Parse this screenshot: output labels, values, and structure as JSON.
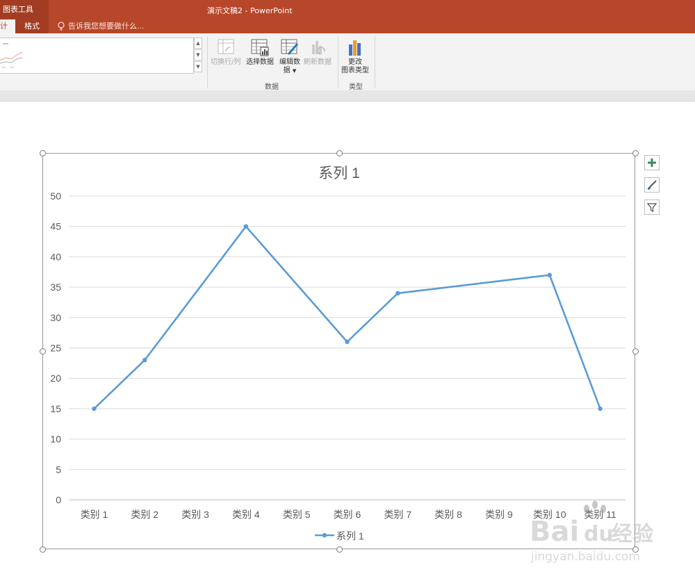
{
  "titlebar": {
    "context_tab": "图表工具",
    "window_title": "演示文稿2 - PowerPoint",
    "tabs": [
      {
        "label": "计",
        "active": true
      },
      {
        "label": "格式",
        "active": false
      }
    ],
    "tell_me": "告诉我您想要做什么..."
  },
  "ribbon": {
    "data_group": {
      "label": "数据",
      "buttons": [
        {
          "label": "切换行/列",
          "enabled": false,
          "icon": "switch-row-column-icon"
        },
        {
          "label": "选择数据",
          "enabled": true,
          "icon": "select-data-icon"
        },
        {
          "label_line1": "编辑数",
          "label_line2": "据",
          "enabled": true,
          "icon": "edit-data-icon"
        },
        {
          "label": "刷新数据",
          "enabled": false,
          "icon": "refresh-data-icon"
        }
      ]
    },
    "type_group": {
      "label": "类型",
      "button": {
        "label_line1": "更改",
        "label_line2": "图表类型",
        "icon": "change-chart-type-icon"
      }
    },
    "gallery_scroll": {
      "up": "▲",
      "down": "▼",
      "more": "▼"
    }
  },
  "chart_data": {
    "type": "line",
    "title": "系列 1",
    "categories": [
      "类别 1",
      "类别 2",
      "类别 3",
      "类别 4",
      "类别 5",
      "类别 6",
      "类别 7",
      "类别 8",
      "类别 9",
      "类别 10",
      "类别 11"
    ],
    "series": [
      {
        "name": "系列 1",
        "values": [
          15,
          23,
          null,
          45,
          null,
          26,
          34,
          null,
          null,
          37,
          15
        ],
        "color": "#5b9bd5"
      }
    ],
    "y_ticks": [
      "0",
      "5",
      "10",
      "15",
      "20",
      "25",
      "30",
      "35",
      "40",
      "45",
      "50"
    ],
    "ylim": [
      0,
      50
    ],
    "grid": true,
    "legend": "bottom"
  },
  "side_buttons": [
    "chart-elements-icon",
    "chart-styles-icon",
    "chart-filters-icon"
  ],
  "watermark": {
    "brand": "Bai",
    "brand2": "du",
    "cn": "经验",
    "url": "jingyan.baidu.com"
  }
}
